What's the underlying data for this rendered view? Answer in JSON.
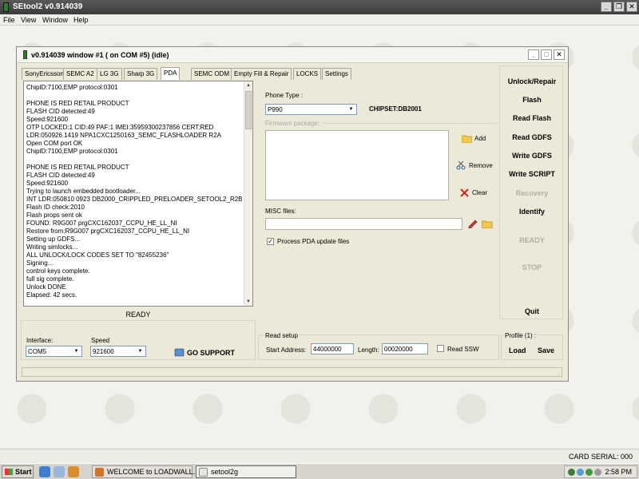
{
  "app": {
    "title": "SEtool2 v0.914039",
    "menu": [
      "File",
      "View",
      "Window",
      "Help"
    ]
  },
  "window": {
    "title": "v0.914039 window #1 ( on COM #5) (idle)",
    "tabs": [
      "SonyEricsson",
      "SEMC A2",
      "LG 3G",
      "Sharp 3G",
      "PDA",
      "SEMC ODM",
      "Empty Fill & Repair",
      "LOCKS",
      "Settings"
    ],
    "active_tab": "PDA"
  },
  "log": [
    "ChipID:7100,EMP protocol:0301",
    "",
    "PHONE IS RED RETAIL PRODUCT",
    "FLASH CID detected:49",
    "Speed:921600",
    "OTP LOCKED:1 CID:49 PAF:1 IMEI:35959300237856 CERT:RED",
    "LDR:050926 1419 NPA1CXC1250163_SEMC_FLASHLOADER R2A",
    "Open COM port OK",
    "ChipID:7100,EMP protocol:0301",
    "",
    "PHONE IS RED RETAIL PRODUCT",
    "FLASH CID detected:49",
    "Speed:921600",
    "Trying to launch embedded bootloader...",
    "INT LDR:050810 0923 DB2000_CRIPPLED_PRELOADER_SETOOL2_R2B",
    "Flash ID check:2010",
    "Flash props sent ok",
    "FOUND: R9G007      prgCXC162037_CCPU_HE_LL_NI",
    "Restore from:R9G007      prgCXC162037_CCPU_HE_LL_NI",
    "Setting up GDFS...",
    "Writing simlocks...",
    "ALL UNLOCK/LOCK CODES SET TO \"82455236\"",
    "Signing...",
    "control keys complete.",
    "full sig complete.",
    "Unlock DONE",
    "Elapsed: 42 secs."
  ],
  "status": "READY",
  "pda": {
    "phone_type_label": "Phone Type :",
    "phone_type_value": "P990",
    "chipset": "CHIPSET:DB2001",
    "firmware_label": "Firmware package:",
    "add_label": "Add",
    "remove_label": "Remove",
    "clear_label": "Clear",
    "misc_label": "MISC files:",
    "process_label": "Process PDA update files",
    "process_checked": true
  },
  "actions": {
    "unlock": "Unlock/Repair",
    "flash": "Flash",
    "read_flash": "Read Flash",
    "read_gdfs": "Read GDFS",
    "write_gdfs": "Write GDFS",
    "write_script": "Write SCRIPT",
    "recovery": "Recovery",
    "identify": "Identify",
    "ready": "READY",
    "stop": "STOP",
    "quit": "Quit"
  },
  "bottom": {
    "interface_label": "Interface:",
    "interface_value": "COM5",
    "speed_label": "Speed",
    "speed_value": "921600",
    "go_support": "GO SUPPORT",
    "read_setup_label": "Read setup",
    "start_address_label": "Start Address:",
    "start_address_value": "44000000",
    "length_label": "Length:",
    "length_value": "00020000",
    "read_ssw_label": "Read SSW",
    "profile_label": "Profile (1) :",
    "load_label": "Load",
    "save_label": "Save"
  },
  "footer": {
    "card_serial": "CARD SERIAL: 000"
  },
  "taskbar": {
    "start": "Start",
    "tasks": [
      "WELCOME to LOADWALL...",
      "setool2g"
    ],
    "clock": "2:58 PM"
  }
}
